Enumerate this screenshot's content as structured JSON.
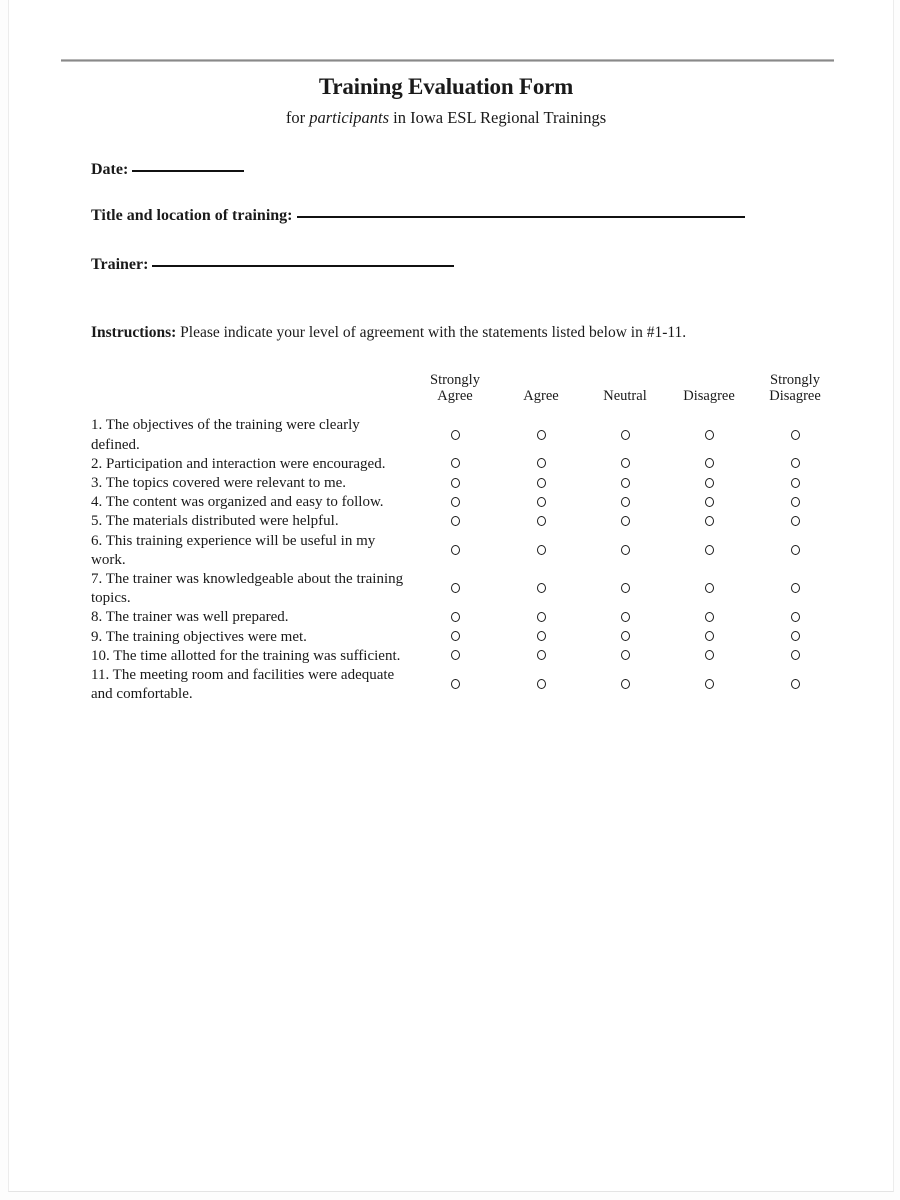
{
  "document": {
    "title": "Training Evaluation Form",
    "subtitle_prefix": "for ",
    "subtitle_italic": "participants",
    "subtitle_suffix": " in Iowa ESL Regional Trainings",
    "fields": [
      {
        "label": "Date:",
        "rule_width": 112
      },
      {
        "label": "Title and location of training:",
        "rule_width": 448
      },
      {
        "label": "Trainer:",
        "rule_width": 302
      }
    ],
    "instructions_label": "Instructions:",
    "instructions_text": " Please indicate your level of agreement with the statements listed below in #1-11."
  },
  "matrix": {
    "statement_header": "",
    "scale": [
      "Strongly\nAgree",
      "Agree",
      "Neutral",
      "Disagree",
      "Strongly\nDisagree"
    ],
    "items": [
      {
        "number": "1.",
        "text": "The objectives of the training were clearly defined."
      },
      {
        "number": "2.",
        "text": "Participation and interaction were encouraged."
      },
      {
        "number": "3.",
        "text": "The topics covered were relevant to me."
      },
      {
        "number": "4.",
        "text": "The content was organized and easy to follow."
      },
      {
        "number": "5.",
        "text": "The materials distributed were helpful."
      },
      {
        "number": "6.",
        "text": "This training experience will be useful in my work."
      },
      {
        "number": "7.",
        "text": "The trainer was knowledgeable about the training topics."
      },
      {
        "number": "8.",
        "text": "The trainer was well prepared."
      },
      {
        "number": "9.",
        "text": "The training objectives were met."
      },
      {
        "number": "10.",
        "text": "The time allotted for the training was sufficient."
      },
      {
        "number": "11.",
        "text": "The meeting room and facilities were adequate and comfortable."
      }
    ]
  },
  "colors": {
    "ink": "#1a1a1a",
    "page": "#ffffff",
    "rule": "#111111"
  }
}
